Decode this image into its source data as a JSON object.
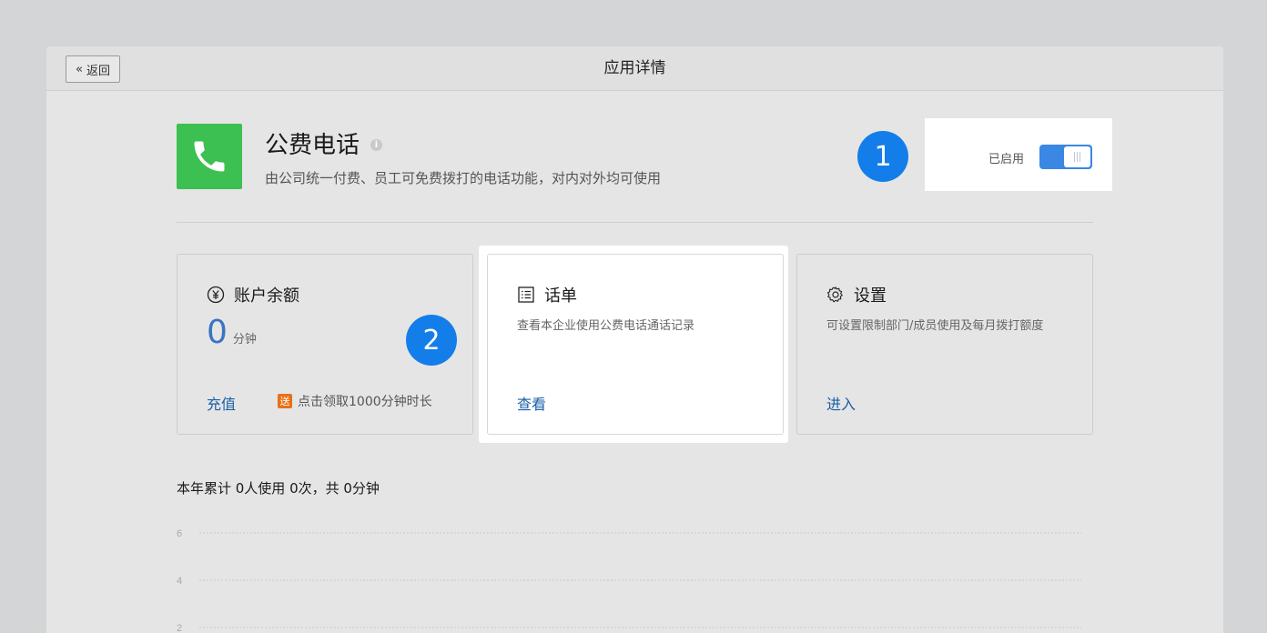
{
  "header": {
    "back_label": "返回",
    "title": "应用详情"
  },
  "app": {
    "name": "公费电话",
    "description": "由公司统一付费、员工可免费拨打的电话功能，对内对外均可使用",
    "icon_color": "#3cc051"
  },
  "status": {
    "label": "已启用",
    "enabled": true,
    "toggle_color": "#3a87e4"
  },
  "badges": [
    "1",
    "2"
  ],
  "cards": {
    "balance": {
      "title": "账户余额",
      "value": "0",
      "unit": "分钟",
      "action": "充值",
      "promo_tag": "送",
      "promo_text": "点击领取1000分钟时长"
    },
    "records": {
      "title": "话单",
      "description": "查看本企业使用公费电话通话记录",
      "action": "查看"
    },
    "settings": {
      "title": "设置",
      "description": "可设置限制部门/成员使用及每月拨打额度",
      "action": "进入"
    }
  },
  "stats_text": "本年累计 0人使用 0次，共 0分钟",
  "chart_data": {
    "type": "line",
    "x": [],
    "series": [],
    "yticks": [
      "6",
      "4",
      "2"
    ],
    "ylim": [
      0,
      6
    ],
    "grid": true
  }
}
